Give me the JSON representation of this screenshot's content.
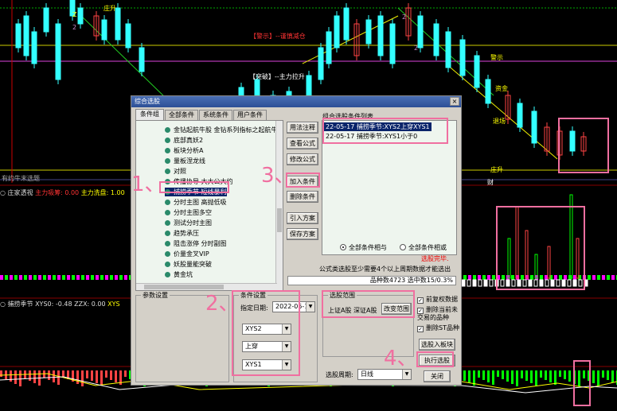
{
  "chart_labels": {
    "top_small": "Z",
    "zhuangli": "庄升",
    "warn": "【警示】--谨慎减仓",
    "break": "【突破】--主力拉升",
    "warn2": "警示",
    "count_left": "2",
    "count_mid": "2",
    "count_2": "2",
    "zhanli": "资金",
    "mai": "卖",
    "tui": "退场",
    "zhua": "抓",
    "zhuang": "庄升",
    "cai": "财",
    "lyr": "有约牛末选题",
    "lp": "L",
    "jz": "亮"
  },
  "pane2": {
    "circle": "○",
    "name": "庄家透视",
    "f1": "主力吸筹: 0.00",
    "f2": "主力洗盘: 1.00"
  },
  "pane3": {
    "circle": "○",
    "name": "捕捞季节",
    "xys0": "XYS0: -0.48",
    "zzx": "ZZX: 0.00",
    "xys": "XYS"
  },
  "dialog": {
    "title": "综合选股",
    "close": "×",
    "tabs": [
      "条件组",
      "全部条件",
      "系统条件",
      "用户条件"
    ],
    "tree_items": [
      "金钻起航牛股 金钻系列指标之起航牛",
      "底部真妖2",
      "板块分析A",
      "量板涅龙线",
      "对照",
      "传播协导 大大公大约",
      "捕捞季节 短线暴利",
      "分时主图 高抛低吸",
      "分时主图多空",
      "测试分时主图",
      "趋势承压",
      "阻击涨停 分时副图",
      "价量金叉VIP",
      "妖股量能突破",
      "黄金坑"
    ],
    "btn_usage": "用法注释",
    "btn_view": "查看公式",
    "btn_modify": "修改公式",
    "btn_add": "加入条件",
    "btn_delete": "删除条件",
    "btn_import": "引入方案",
    "btn_save": "保存方案",
    "list_title": "组合选股条件列表",
    "conditions": [
      "22-05-17 捕捞季节:XYS2上穿XYS1",
      "22-05-17 捕捞季节:XYS1小于0"
    ],
    "radio_and": "全部条件相与",
    "radio_or": "全部条件相或",
    "warn_text": "选股完毕.",
    "note": "公式类选股至少需要4个以上周期数据才能选出",
    "stat": "品种数4723  选中数15/0.3%",
    "params_title": "参数设置",
    "cond_title": "条件设置",
    "date_label": "指定日期:",
    "date_value": "2022-05-17",
    "sel1": "XYS2",
    "sel2": "上穿",
    "sel3": "XYS1",
    "range_title": "选股范围",
    "range_value": "上证A股 深证A股",
    "btn_range": "改变范围",
    "cb_restore": "前复权数据",
    "cb_exclude": "删除当前未交易的品种",
    "cb_st": "删除ST品种",
    "btn_to_block": "选股入板块",
    "btn_execute": "执行选股",
    "period_label": "选股周期:",
    "period_value": "日线",
    "btn_close": "关闭",
    "arrow": "▼",
    "check": "✓"
  },
  "steps": [
    "1、",
    "2、",
    "3、",
    "4、"
  ]
}
